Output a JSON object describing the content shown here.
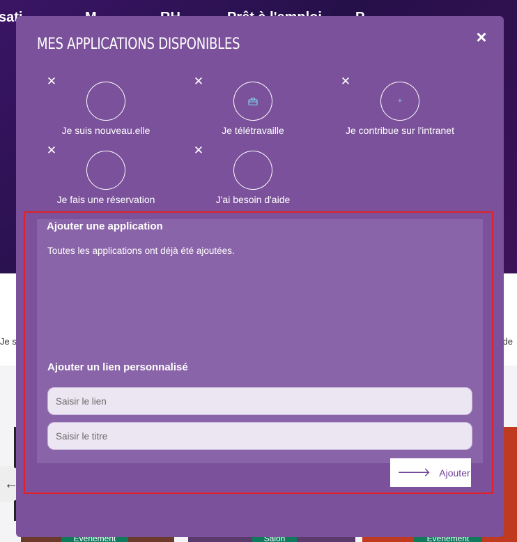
{
  "background": {
    "nav_items": [
      "sati",
      "M",
      "RH",
      "Prêt à l'emploi",
      "P"
    ],
    "row_left": "Je s",
    "row_right": "de",
    "badges": [
      "Événement",
      "Salon",
      "Événement"
    ]
  },
  "modal": {
    "title": "MES APPLICATIONS DISPONIBLES",
    "close_icon": "×",
    "apps": [
      {
        "label": "Je suis nouveau.elle",
        "icon": ""
      },
      {
        "label": "Je télétravaille",
        "icon": "briefcase-icon"
      },
      {
        "label": "Je contribue sur l'intranet",
        "icon": "plus-icon"
      },
      {
        "label": "Je fais une réservation",
        "icon": ""
      },
      {
        "label": "J'ai besoin d'aide",
        "icon": ""
      }
    ],
    "add_app": {
      "title": "Ajouter une application",
      "message": "Toutes les applications ont déjà été ajoutées."
    },
    "custom_link": {
      "title": "Ajouter un lien personnalisé",
      "link_placeholder": "Saisir le lien",
      "title_placeholder": "Saisir le titre",
      "button_label": "Ajouter"
    }
  },
  "colors": {
    "modal_bg": "#7a519a",
    "panel_bg": "#8a64a8",
    "highlight": "#e0202a",
    "accent": "#6e3f96"
  }
}
